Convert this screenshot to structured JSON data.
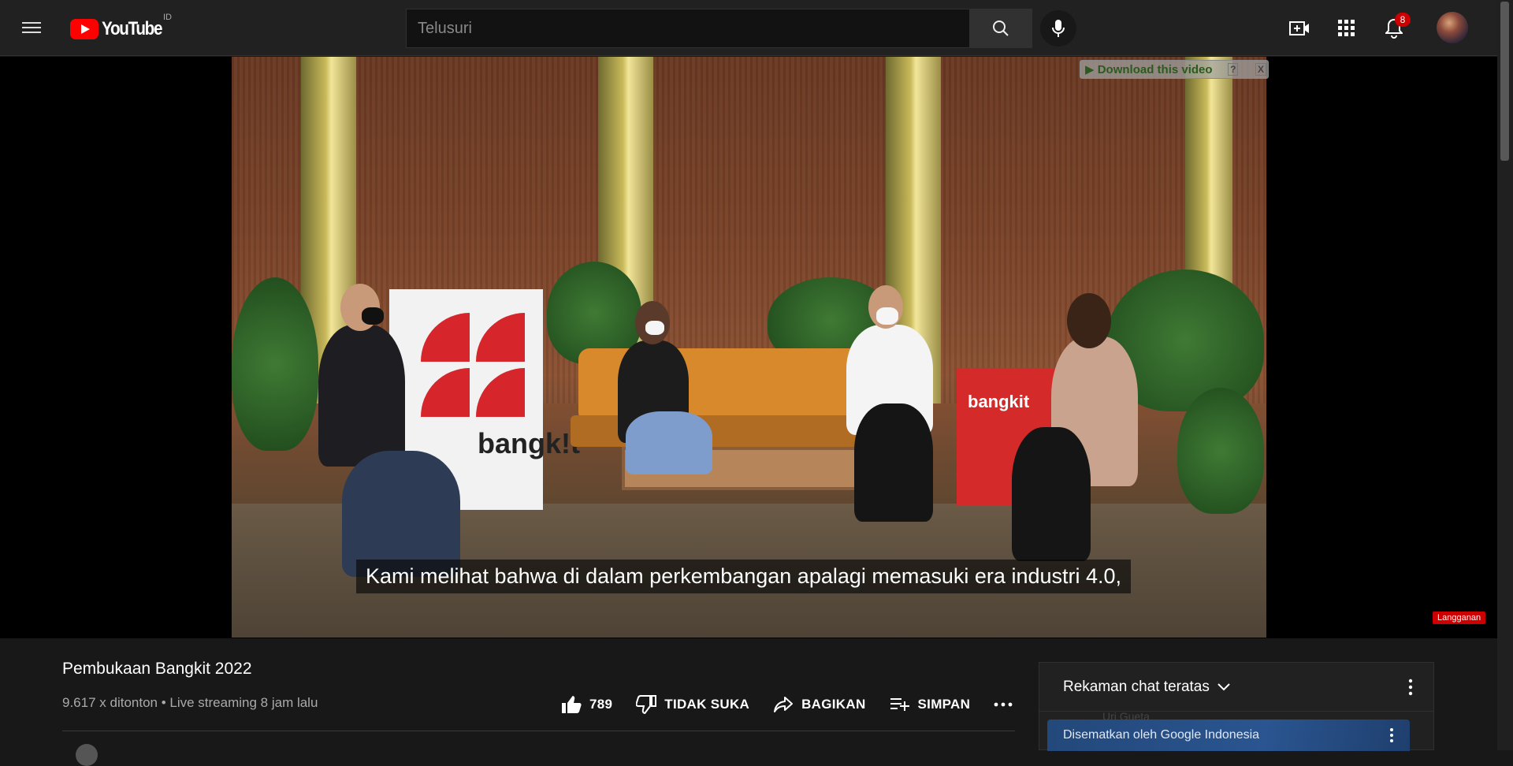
{
  "header": {
    "logo_text": "YouTube",
    "region_code": "ID",
    "search_placeholder": "Telusuri",
    "notification_count": "8"
  },
  "video": {
    "subtitle": "Kami melihat bahwa di dalam perkembangan apalagi memasuki era industri 4.0,",
    "download_label": "▶ Download this video",
    "download_help": "?",
    "download_close": "X",
    "watermark_label": "Langganan",
    "stand_text": "bangk!t",
    "redbox_text": "bangkit"
  },
  "info": {
    "title": "Pembukaan Bangkit 2022",
    "meta": "9.617 x ditonton • Live streaming 8 jam lalu",
    "like_count": "789",
    "dislike_label": "TIDAK SUKA",
    "share_label": "BAGIKAN",
    "save_label": "SIMPAN"
  },
  "chat": {
    "header_label": "Rekaman chat teratas",
    "pinned_label": "Disematkan oleh Google Indonesia",
    "ghost_text": "Uri Gueta"
  }
}
